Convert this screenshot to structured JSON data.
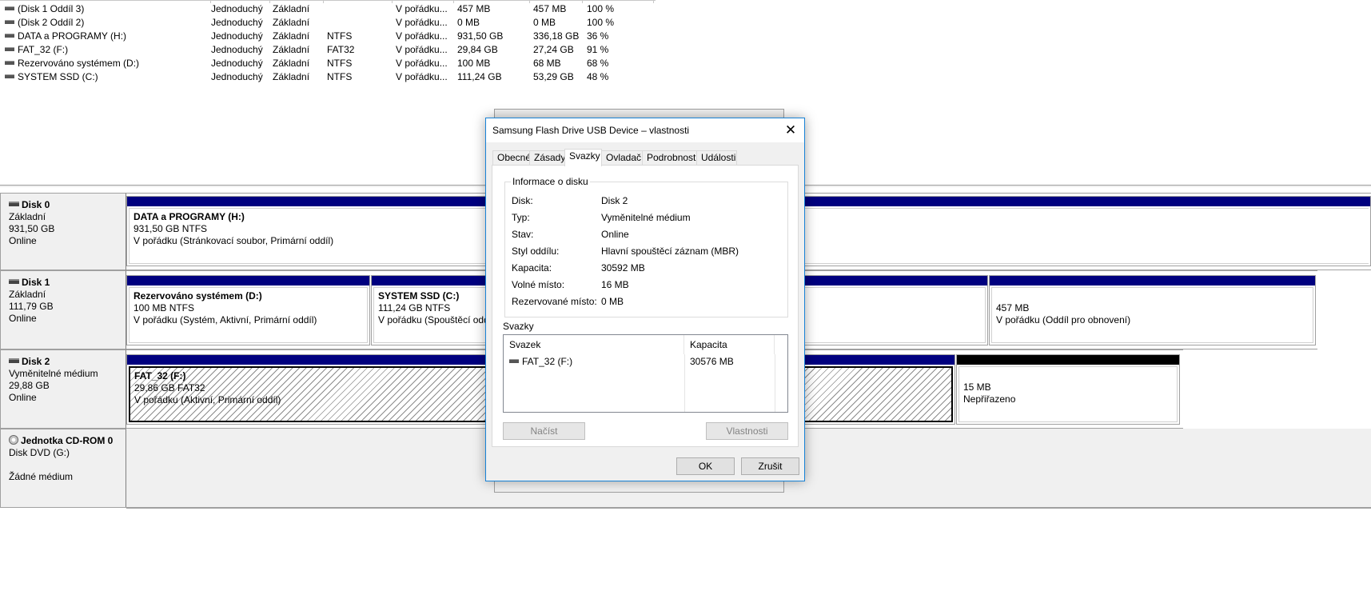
{
  "volume_list": {
    "rows": [
      {
        "name": "(Disk 1 Oddíl 3)",
        "layout": "Jednoduchý",
        "type": "Základní",
        "fs": "",
        "status": "V pořádku...",
        "capacity": "457 MB",
        "free": "457 MB",
        "pct": "100 %"
      },
      {
        "name": "(Disk 2 Oddíl 2)",
        "layout": "Jednoduchý",
        "type": "Základní",
        "fs": "",
        "status": "V pořádku...",
        "capacity": "0 MB",
        "free": "0 MB",
        "pct": "100 %"
      },
      {
        "name": "DATA a PROGRAMY (H:)",
        "layout": "Jednoduchý",
        "type": "Základní",
        "fs": "NTFS",
        "status": "V pořádku...",
        "capacity": "931,50 GB",
        "free": "336,18 GB",
        "pct": "36 %"
      },
      {
        "name": "FAT_32 (F:)",
        "layout": "Jednoduchý",
        "type": "Základní",
        "fs": "FAT32",
        "status": "V pořádku...",
        "capacity": "29,84 GB",
        "free": "27,24 GB",
        "pct": "91 %"
      },
      {
        "name": "Rezervováno systémem (D:)",
        "layout": "Jednoduchý",
        "type": "Základní",
        "fs": "NTFS",
        "status": "V pořádku...",
        "capacity": "100 MB",
        "free": "68 MB",
        "pct": "68 %"
      },
      {
        "name": "SYSTEM SSD (C:)",
        "layout": "Jednoduchý",
        "type": "Základní",
        "fs": "NTFS",
        "status": "V pořádku...",
        "capacity": "111,24 GB",
        "free": "53,29 GB",
        "pct": "48 %"
      }
    ]
  },
  "disks": {
    "disk0": {
      "name": "Disk 0",
      "type": "Základní",
      "size": "931,50 GB",
      "state": "Online",
      "p1": {
        "title": "DATA a PROGRAMY  (H:)",
        "line1": "931,50 GB NTFS",
        "line2": "V pořádku (Stránkovací soubor, Primární oddíl)"
      }
    },
    "disk1": {
      "name": "Disk 1",
      "type": "Základní",
      "size": "111,79 GB",
      "state": "Online",
      "p1": {
        "title": "Rezervováno systémem  (D:)",
        "line1": "100 MB NTFS",
        "line2": "V pořádku (Systém, Aktivní, Primární oddíl)"
      },
      "p2": {
        "title": "SYSTEM SSD  (C:)",
        "line1": "111,24 GB NTFS",
        "line2": "V pořádku (Spouštěcí oddíl"
      },
      "p3": {
        "line1": "457 MB",
        "line2": "V pořádku (Oddíl pro obnovení)"
      }
    },
    "disk2": {
      "name": "Disk 2",
      "type": "Vyměnitelné médium",
      "size": "29,88 GB",
      "state": "Online",
      "p1": {
        "title": "FAT_32  (F:)",
        "line1": "29,86 GB FAT32",
        "line2": "V pořádku (Aktivní, Primární oddíl)"
      },
      "p2": {
        "line1": "15 MB",
        "line2": "Nepřiřazeno"
      }
    },
    "cdrom0": {
      "name": "Jednotka CD-ROM 0",
      "type": "Disk DVD (G:)",
      "state": "Žádné médium"
    }
  },
  "dialog": {
    "title": "Samsung Flash Drive USB Device – vlastnosti",
    "close_glyph": "✕",
    "tabs": [
      "Obecné",
      "Zásady",
      "Svazky",
      "Ovladač",
      "Podrobnosti",
      "Události"
    ],
    "active_tab": "Svazky",
    "info_group_title": "Informace o disku",
    "info": [
      {
        "key": "Disk:",
        "value": "Disk 2"
      },
      {
        "key": "Typ:",
        "value": "Vyměnitelné médium"
      },
      {
        "key": "Stav:",
        "value": "Online"
      },
      {
        "key": "Styl oddílu:",
        "value": "Hlavní spouštěcí záznam (MBR)"
      },
      {
        "key": "Kapacita:",
        "value": "30592 MB"
      },
      {
        "key": "Volné místo:",
        "value": "16 MB"
      },
      {
        "key": "Rezervované místo:",
        "value": "0 MB"
      }
    ],
    "volumes_label": "Svazky",
    "volumes_table": {
      "headers": [
        "Svazek",
        "Kapacita"
      ],
      "rows": [
        {
          "volume": "FAT_32 (F:)",
          "capacity": "30576 MB"
        }
      ]
    },
    "buttons": {
      "load": "Načíst",
      "properties": "Vlastnosti",
      "ok": "OK",
      "cancel": "Zrušit"
    }
  },
  "colors": {
    "partition_bar": "#00007f",
    "unallocated_bar": "#000000",
    "dialog_border": "#1883d7"
  }
}
